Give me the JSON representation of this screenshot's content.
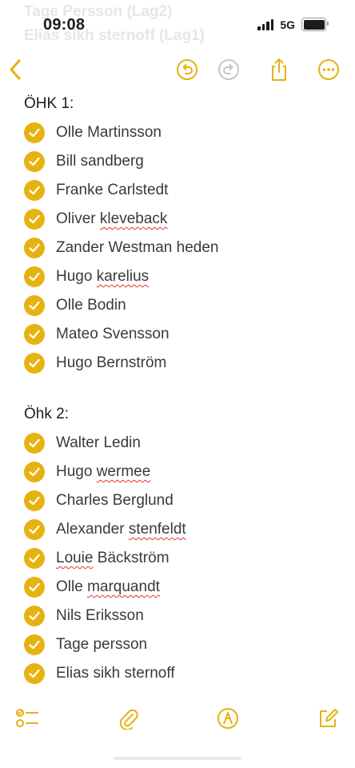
{
  "status_bar": {
    "time": "09:08",
    "network": "5G",
    "background_text": [
      "Tage Persson (Lag2)",
      "Elias sikh sternoff (Lag1)"
    ]
  },
  "toolbar": {
    "icons": [
      "back-chevron-icon",
      "undo-icon",
      "redo-icon",
      "share-icon",
      "more-icon"
    ]
  },
  "accent_color": "#e6b20e",
  "sections": [
    {
      "heading": "ÖHK 1:",
      "items": [
        {
          "parts": [
            {
              "text": "Olle Martinsson",
              "err": false
            }
          ],
          "checked": true
        },
        {
          "parts": [
            {
              "text": "Bill sandberg",
              "err": false
            }
          ],
          "checked": true
        },
        {
          "parts": [
            {
              "text": "Franke Carlstedt",
              "err": false
            }
          ],
          "checked": true
        },
        {
          "parts": [
            {
              "text": "Oliver ",
              "err": false
            },
            {
              "text": "kleveback",
              "err": true
            }
          ],
          "checked": true
        },
        {
          "parts": [
            {
              "text": "Zander Westman heden",
              "err": false
            }
          ],
          "checked": true
        },
        {
          "parts": [
            {
              "text": "Hugo ",
              "err": false
            },
            {
              "text": "karelius",
              "err": true
            }
          ],
          "checked": true
        },
        {
          "parts": [
            {
              "text": "Olle Bodin",
              "err": false
            }
          ],
          "checked": true
        },
        {
          "parts": [
            {
              "text": "Mateo Svensson",
              "err": false
            }
          ],
          "checked": true
        },
        {
          "parts": [
            {
              "text": "Hugo Bernström",
              "err": false
            }
          ],
          "checked": true
        }
      ]
    },
    {
      "heading": "Öhk 2:",
      "items": [
        {
          "parts": [
            {
              "text": "Walter Ledin",
              "err": false
            }
          ],
          "checked": true
        },
        {
          "parts": [
            {
              "text": "Hugo ",
              "err": false
            },
            {
              "text": "wermee",
              "err": true
            }
          ],
          "checked": true
        },
        {
          "parts": [
            {
              "text": "Charles Berglund",
              "err": false
            }
          ],
          "checked": true
        },
        {
          "parts": [
            {
              "text": "Alexander ",
              "err": false
            },
            {
              "text": "stenfeldt",
              "err": true
            }
          ],
          "checked": true
        },
        {
          "parts": [
            {
              "text": "Louie",
              "err": true
            },
            {
              "text": " Bäckström",
              "err": false
            }
          ],
          "checked": true
        },
        {
          "parts": [
            {
              "text": "Olle ",
              "err": false
            },
            {
              "text": "marquandt",
              "err": true
            }
          ],
          "checked": true
        },
        {
          "parts": [
            {
              "text": "Nils Eriksson",
              "err": false
            }
          ],
          "checked": true
        },
        {
          "parts": [
            {
              "text": "Tage persson",
              "err": false
            }
          ],
          "checked": true
        },
        {
          "parts": [
            {
              "text": "Elias sikh sternoff",
              "err": false
            }
          ],
          "checked": true
        }
      ]
    }
  ],
  "bottom_bar": {
    "icons": [
      "checklist-icon",
      "attachment-icon",
      "markup-icon",
      "compose-icon"
    ]
  }
}
